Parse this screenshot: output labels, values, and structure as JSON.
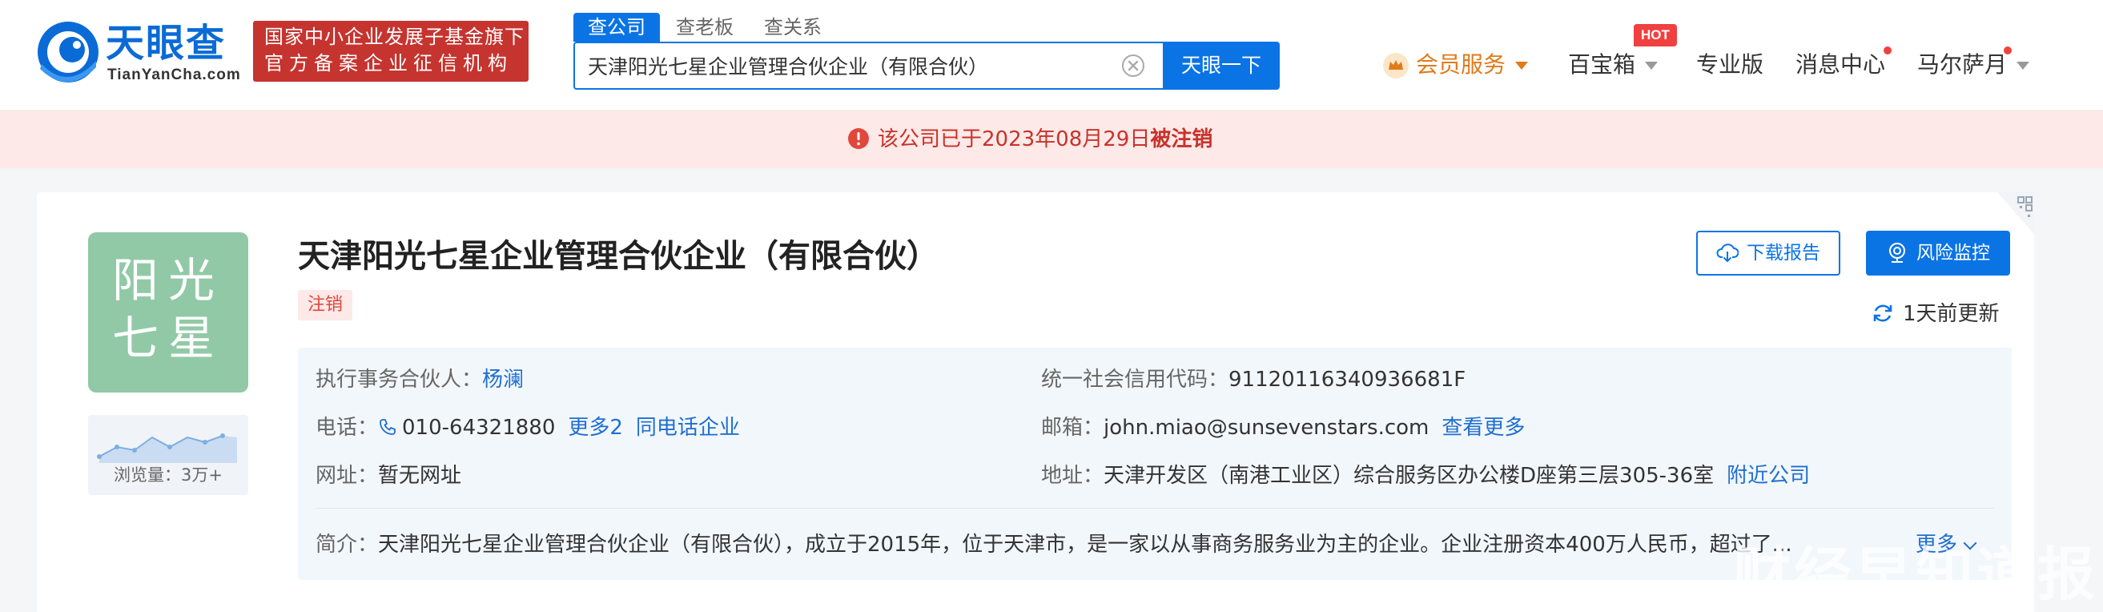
{
  "header": {
    "logo_cn": "天眼查",
    "logo_en": "TianYanCha.com",
    "badge_line1": "国家中小企业发展子基金旗下",
    "badge_line2": "官方备案企业征信机构",
    "search_tabs": [
      {
        "label": "查公司",
        "active": true
      },
      {
        "label": "查老板",
        "active": false
      },
      {
        "label": "查关系",
        "active": false
      }
    ],
    "search_value": "天津阳光七星企业管理合伙企业（有限合伙）",
    "search_button": "天眼一下",
    "nav": {
      "vip": "会员服务",
      "box": "百宝箱",
      "hot": "HOT",
      "pro": "专业版",
      "messages": "消息中心",
      "user": "马尔萨月"
    },
    "accent": "#0b74e5"
  },
  "notice": {
    "prefix": "该公司已于2023年08月29日",
    "status": "被注销",
    "color": "#c8322b"
  },
  "company": {
    "logo_line1": "阳光",
    "logo_line2": "七星",
    "logo_color": "#91c9a6",
    "name": "天津阳光七星企业管理合伙企业（有限合伙）",
    "status_tag": "注销",
    "views": "浏览量：3万+",
    "download_button": "下载报告",
    "monitor_button": "风险监控",
    "updated": "1天前更新"
  },
  "info": {
    "partner_label": "执行事务合伙人：",
    "partner_value": "杨澜",
    "credit_label": "统一社会信用代码：",
    "credit_value": "91120116340936681F",
    "phone_label": "电话：",
    "phone_value": "010-64321880",
    "phone_more": "更多2",
    "phone_same": "同电话企业",
    "email_label": "邮箱：",
    "email_value": "john.miao@sunsevenstars.com",
    "email_more": "查看更多",
    "website_label": "网址：",
    "website_value": "暂无网址",
    "address_label": "地址：",
    "address_value": "天津开发区（南港工业区）综合服务区办公楼D座第三层305-36室",
    "address_nearby": "附近公司",
    "intro_label": "简介：",
    "intro_value": "天津阳光七星企业管理合伙企业（有限合伙），成立于2015年，位于天津市，是一家以从事商务服务业为主的企业。企业注册资本400万人民币，超过了...",
    "intro_more": "更多"
  },
  "watermark": "财经早知道报"
}
